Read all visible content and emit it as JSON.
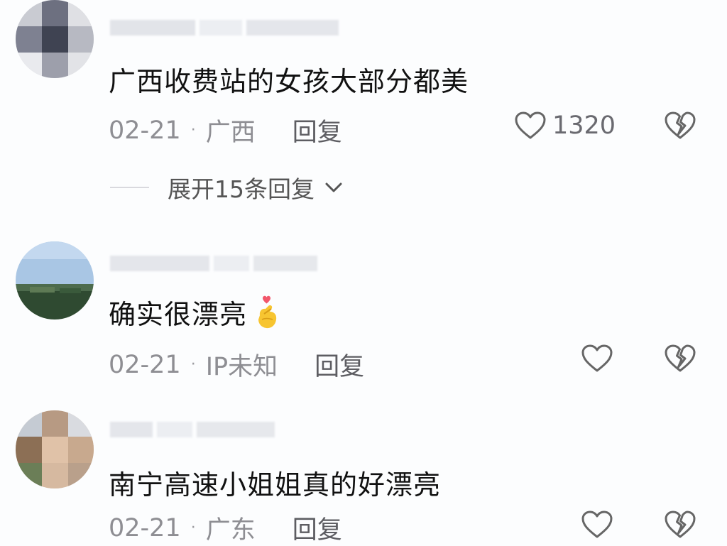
{
  "comments": [
    {
      "text": "广西收费站的女孩大部分都美",
      "date": "02-21",
      "location": "广西",
      "reply_label": "回复",
      "likes": "1320"
    },
    {
      "text": "确实很漂亮",
      "emoji": "🫰",
      "date": "02-21",
      "location": "IP未知",
      "reply_label": "回复"
    },
    {
      "text": "南宁高速小姐姐真的好漂亮",
      "date": "02-21",
      "location": "广东",
      "reply_label": "回复"
    }
  ],
  "expand_replies": {
    "label": "展开15条回复"
  },
  "icons": {
    "like": "heart-outline-icon",
    "dislike": "broken-heart-icon",
    "expand": "chevron-down-icon"
  },
  "colors": {
    "background": "#fcfdfe",
    "text_primary": "#111111",
    "text_secondary": "#8e8e93",
    "icon": "#666666"
  }
}
